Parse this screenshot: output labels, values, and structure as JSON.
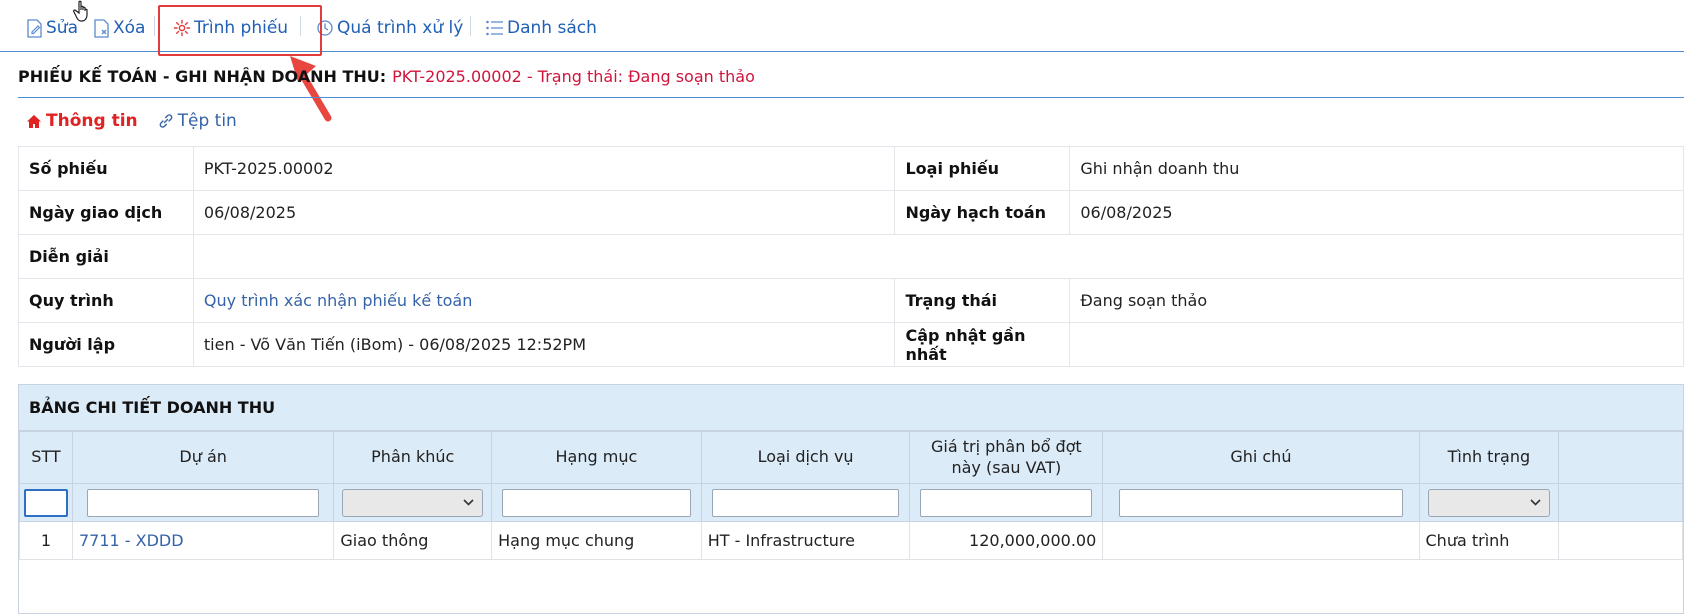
{
  "toolbar": {
    "edit_label": "Sửa",
    "delete_label": "Xóa",
    "submit_label": "Trình phiếu",
    "process_label": "Quá trình xử lý",
    "list_label": "Danh sách"
  },
  "header": {
    "title": "PHIẾU KẾ TOÁN - GHI NHẬN DOANH THU:",
    "status": "PKT-2025.00002 - Trạng thái: Đang soạn thảo"
  },
  "tabs": [
    {
      "label": "Thông tin"
    },
    {
      "label": "Tệp tin"
    }
  ],
  "info": {
    "so_phieu_label": "Số phiếu",
    "so_phieu_value": "PKT-2025.00002",
    "loai_phieu_label": "Loại phiếu",
    "loai_phieu_value": "Ghi nhận doanh thu",
    "ngay_gd_label": "Ngày giao dịch",
    "ngay_gd_value": "06/08/2025",
    "ngay_ht_label": "Ngày hạch toán",
    "ngay_ht_value": "06/08/2025",
    "dien_giai_label": "Diễn giải",
    "dien_giai_value": "",
    "quy_trinh_label": "Quy trình",
    "quy_trinh_value": "Quy trình xác nhận phiếu kế toán",
    "trang_thai_label": "Trạng thái",
    "trang_thai_value": "Đang soạn thảo",
    "nguoi_lap_label": "Người lập",
    "nguoi_lap_value": "tien - Võ Văn Tiến (iBom) - 06/08/2025 12:52PM",
    "cap_nhat_label": "Cập nhật gần nhất",
    "cap_nhat_value": ""
  },
  "detail": {
    "title": "BẢNG CHI TIẾT DOANH THU",
    "columns": [
      "STT",
      "Dự án",
      "Phân khúc",
      "Hạng mục",
      "Loại dịch vụ",
      "Giá trị phân bổ đợt này (sau VAT)",
      "Ghi chú",
      "Tình trạng"
    ],
    "rows": [
      {
        "stt": "1",
        "du_an": "7711 - XDDD",
        "phan_khuc": "Giao thông",
        "hang_muc": "Hạng mục chung",
        "loai_dv": "HT - Infrastructure",
        "gia_tri": "120,000,000.00",
        "ghi_chu": "",
        "tinh_trang": "Chưa trình"
      }
    ]
  },
  "colors": {
    "accent": "#1f5fb5",
    "status_red": "#d0143c",
    "header_bg": "#dcebf8",
    "highlight": "#e23b3b"
  }
}
